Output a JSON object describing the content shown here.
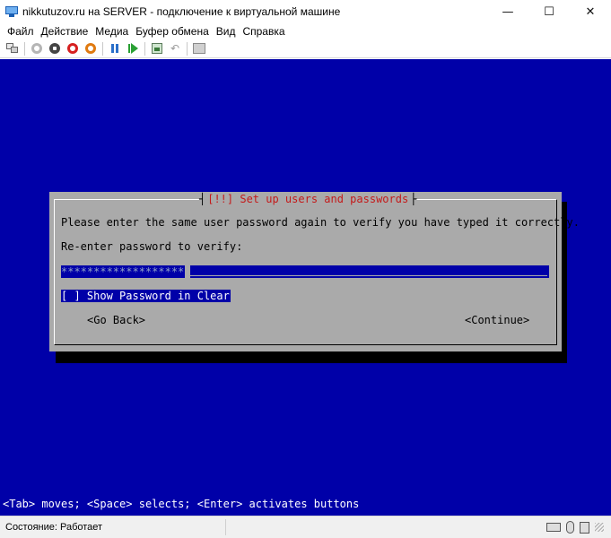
{
  "window": {
    "title": "nikkutuzov.ru на SERVER - подключение к виртуальной машине",
    "controls": {
      "minimize": "—",
      "maximize": "☐",
      "close": "✕"
    }
  },
  "menu": [
    "Файл",
    "Действие",
    "Медиа",
    "Буфер обмена",
    "Вид",
    "Справка"
  ],
  "toolbar": {
    "icons": [
      "ctrl-alt-del-icon",
      "start-icon",
      "turn-off-icon",
      "shut-down-icon",
      "save-icon",
      "pause-icon",
      "reset-icon",
      "checkpoint-icon",
      "revert-icon",
      "enhanced-session-icon"
    ]
  },
  "installer": {
    "dialog_title": "[!!] Set up users and passwords",
    "title_left_bracket": "┤",
    "title_right_bracket": "├",
    "prompt": "Please enter the same user password again to verify you have typed it correctly.",
    "field_label": "Re-enter password to verify:",
    "password_value": "*******************",
    "checkbox": "[ ] Show Password in Clear",
    "go_back": "<Go Back>",
    "continue": "<Continue>",
    "hint": "<Tab> moves; <Space> selects; <Enter> activates buttons"
  },
  "status": {
    "text": "Состояние: Работает"
  },
  "colors": {
    "console_bg": "#0000a8",
    "dialog_bg": "#aaaaaa",
    "title_red": "#c41a1a"
  }
}
